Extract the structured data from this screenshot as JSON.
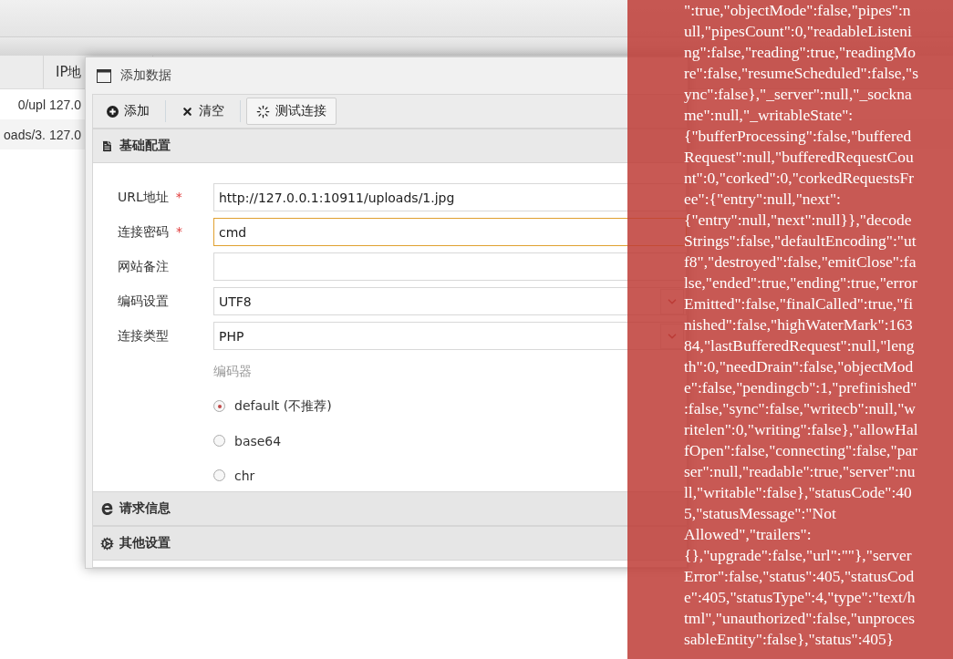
{
  "table": {
    "header": "IP地",
    "rows": [
      {
        "column_1": "0/upl",
        "ip": "127.0"
      },
      {
        "column_1": "oads/3.",
        "ip": "127.0"
      }
    ]
  },
  "dialog": {
    "title": "添加数据",
    "toolbar": [
      {
        "kind": "add",
        "label": "添加"
      },
      {
        "kind": "clear",
        "label": "清空"
      },
      {
        "kind": "test",
        "label": "测试连接"
      }
    ],
    "sections": [
      {
        "kind": "basic",
        "title": "基础配置",
        "expanded": true
      },
      {
        "kind": "request",
        "title": "请求信息",
        "expanded": false
      },
      {
        "kind": "other",
        "title": "其他设置",
        "expanded": false
      }
    ],
    "fields": [
      {
        "kind": "text",
        "label": "URL地址",
        "mark": "*",
        "value": "http://127.0.0.1:10911/uploads/1.jpg",
        "focused": false
      },
      {
        "kind": "text",
        "label": "连接密码",
        "mark": "*",
        "value": "cmd",
        "focused": true
      },
      {
        "kind": "text",
        "label": "网站备注",
        "focused": false
      },
      {
        "kind": "select",
        "label": "编码设置",
        "value": "UTF8",
        "focused": false
      },
      {
        "kind": "select",
        "label": "连接类型",
        "value": "PHP",
        "focused": false
      }
    ],
    "encoder": {
      "label": "编码器",
      "options": [
        {
          "label": "default (不推荐)",
          "selected": true
        },
        {
          "label": "base64",
          "selected": false
        },
        {
          "label": "chr",
          "selected": false
        }
      ]
    }
  },
  "error_toast": {
    "lines": [
      "\":true,\"objectMode\":false,\"pipes\":n",
      "ull,\"pipesCount\":0,\"readableListeni",
      "ng\":false,\"reading\":true,\"readingMo",
      "re\":false,\"resumeScheduled\":false,\"s",
      "ync\":false},\"_server\":null,\"_sockna",
      "me\":null,\"_writableState\":",
      "{\"bufferProcessing\":false,\"buffered",
      "Request\":null,\"bufferedRequestCou",
      "nt\":0,\"corked\":0,\"corkedRequestsFr",
      "ee\":{\"entry\":null,\"next\":",
      "{\"entry\":null,\"next\":null}},\"decode",
      "Strings\":false,\"defaultEncoding\":\"ut",
      "f8\",\"destroyed\":false,\"emitClose\":fa",
      "lse,\"ended\":true,\"ending\":true,\"error",
      "Emitted\":false,\"finalCalled\":true,\"fi",
      "nished\":false,\"highWaterMark\":163",
      "84,\"lastBufferedRequest\":null,\"leng",
      "th\":0,\"needDrain\":false,\"objectMod",
      "e\":false,\"pendingcb\":1,\"prefinished\"",
      ":false,\"sync\":false,\"writecb\":null,\"w",
      "ritelen\":0,\"writing\":false},\"allowHal",
      "fOpen\":false,\"connecting\":false,\"par",
      "ser\":null,\"readable\":true,\"server\":nu",
      "ll,\"writable\":false},\"statusCode\":40",
      "5,\"statusMessage\":\"Not",
      "Allowed\",\"trailers\":",
      "{},\"upgrade\":false,\"url\":\"\"},\"server",
      "Error\":false,\"status\":405,\"statusCod",
      "e\":405,\"statusType\":4,\"type\":\"text/h",
      "tml\",\"unauthorized\":false,\"unproces",
      "sableEntity\":false},\"status\":405}"
    ]
  }
}
